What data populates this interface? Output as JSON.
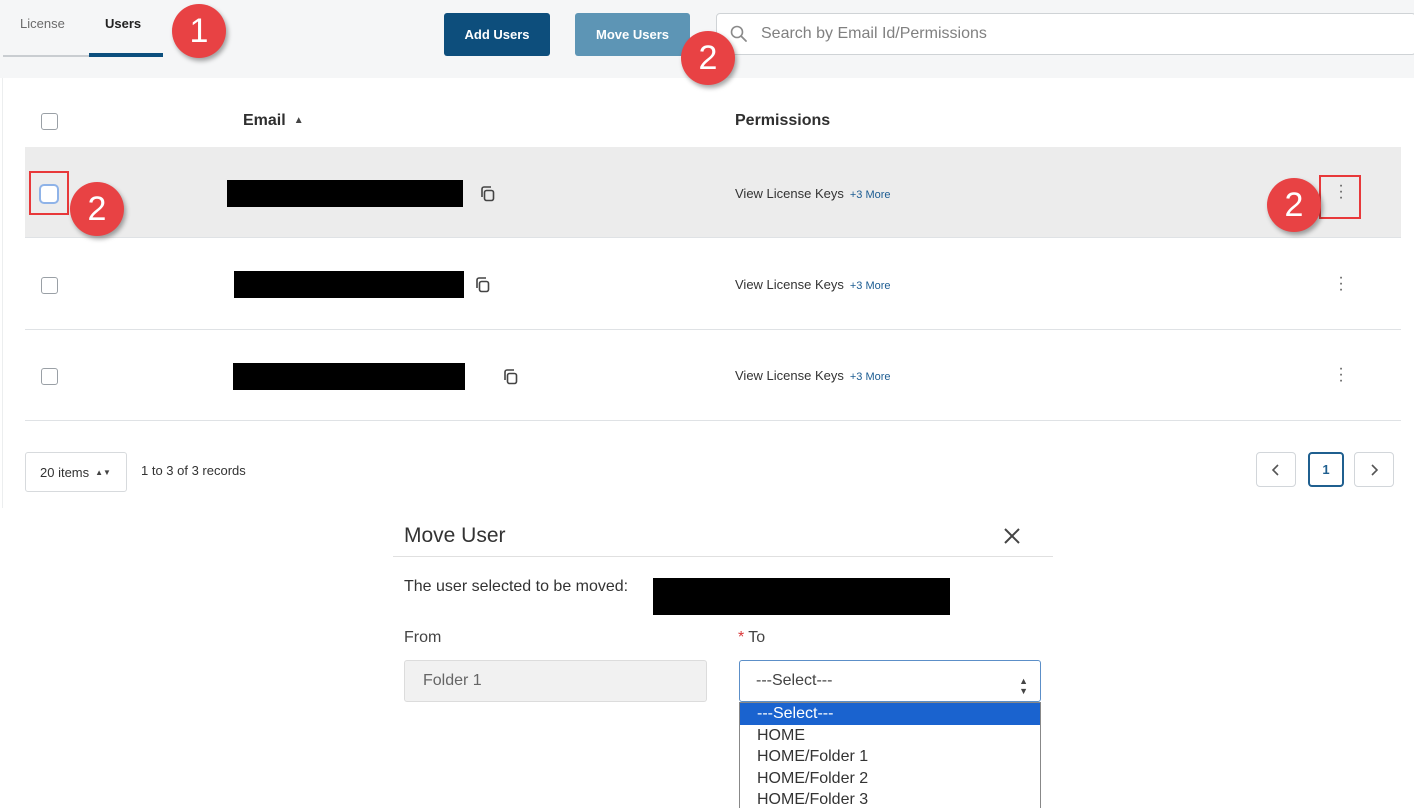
{
  "tabs": [
    {
      "label": "License"
    },
    {
      "label": "Users",
      "active": true
    }
  ],
  "toolbar": {
    "add_users_label": "Add Users",
    "move_users_label": "Move Users"
  },
  "search": {
    "placeholder": "Search by Email Id/Permissions",
    "icon": "search-icon"
  },
  "badges": [
    "1",
    "2",
    "2",
    "2"
  ],
  "table": {
    "columns": [
      "Email",
      "Permissions"
    ],
    "rows": [
      {
        "email": "[redacted]",
        "permission": "View License Keys",
        "more": "+3 More",
        "selected": true
      },
      {
        "email": "[redacted]",
        "permission": "View License Keys",
        "more": "+3 More",
        "selected": false
      },
      {
        "email": "[redacted]",
        "permission": "View License Keys",
        "more": "+3 More",
        "selected": false
      }
    ]
  },
  "pager": {
    "page_size": "20 items",
    "records": "1 to 3 of 3 records",
    "current_page": "1"
  },
  "modal": {
    "title": "Move User",
    "message": "The user selected to be moved:",
    "from_label": "From",
    "from_value": "Folder 1",
    "to_label": "To",
    "to_required_mark": "*",
    "to_selected": "---Select---",
    "options": [
      "---Select---",
      "HOME",
      "HOME/Folder 1",
      "HOME/Folder 2",
      "HOME/Folder 3"
    ]
  },
  "colors": {
    "primary": "#0d4e7c",
    "secondary": "#5d95b5",
    "badge": "#e84244",
    "selected_option": "#1a63cf"
  }
}
